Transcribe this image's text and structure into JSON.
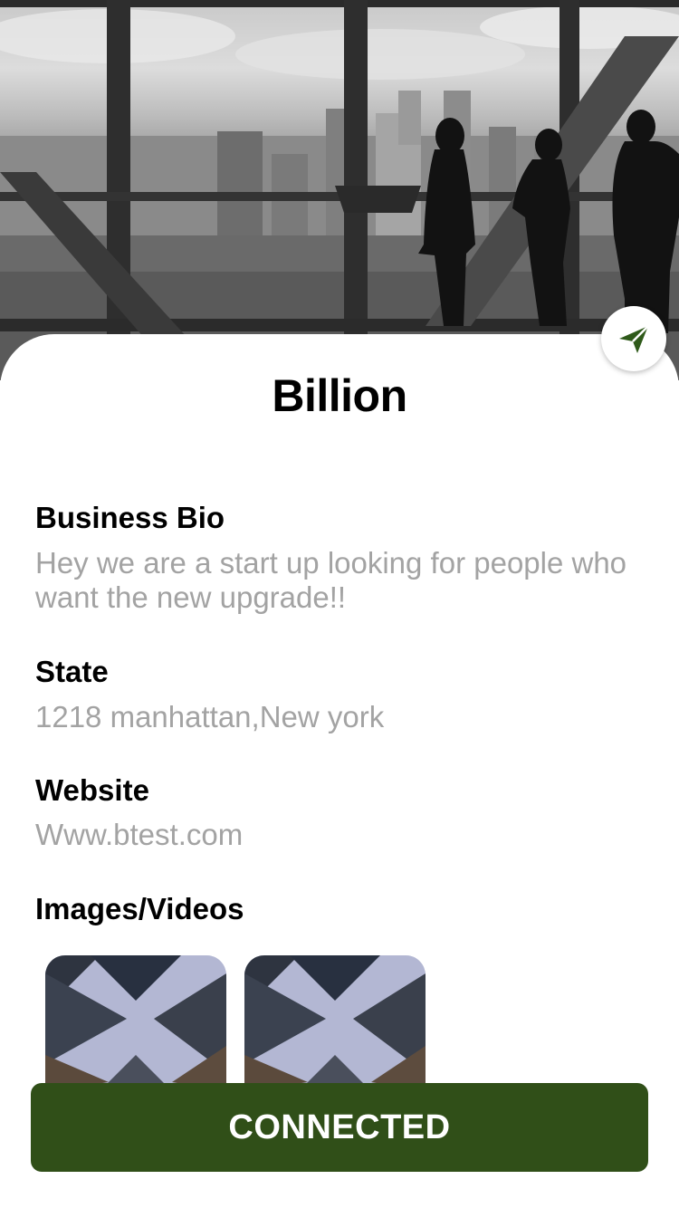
{
  "business": {
    "name": "Billion"
  },
  "sections": {
    "bio": {
      "label": "Business Bio",
      "value": "Hey we are a start up looking for people who want the new upgrade!!"
    },
    "state": {
      "label": "State",
      "value": "1218 manhattan,New york"
    },
    "website": {
      "label": "Website",
      "value": "Www.btest.com"
    },
    "media": {
      "label": "Images/Videos"
    }
  },
  "actions": {
    "status_button_label": "CONNECTED"
  },
  "icons": {
    "send": "send-icon"
  },
  "colors": {
    "accent": "#304f18",
    "label_text": "#000000",
    "value_text": "#a3a3a3",
    "background": "#ffffff"
  }
}
